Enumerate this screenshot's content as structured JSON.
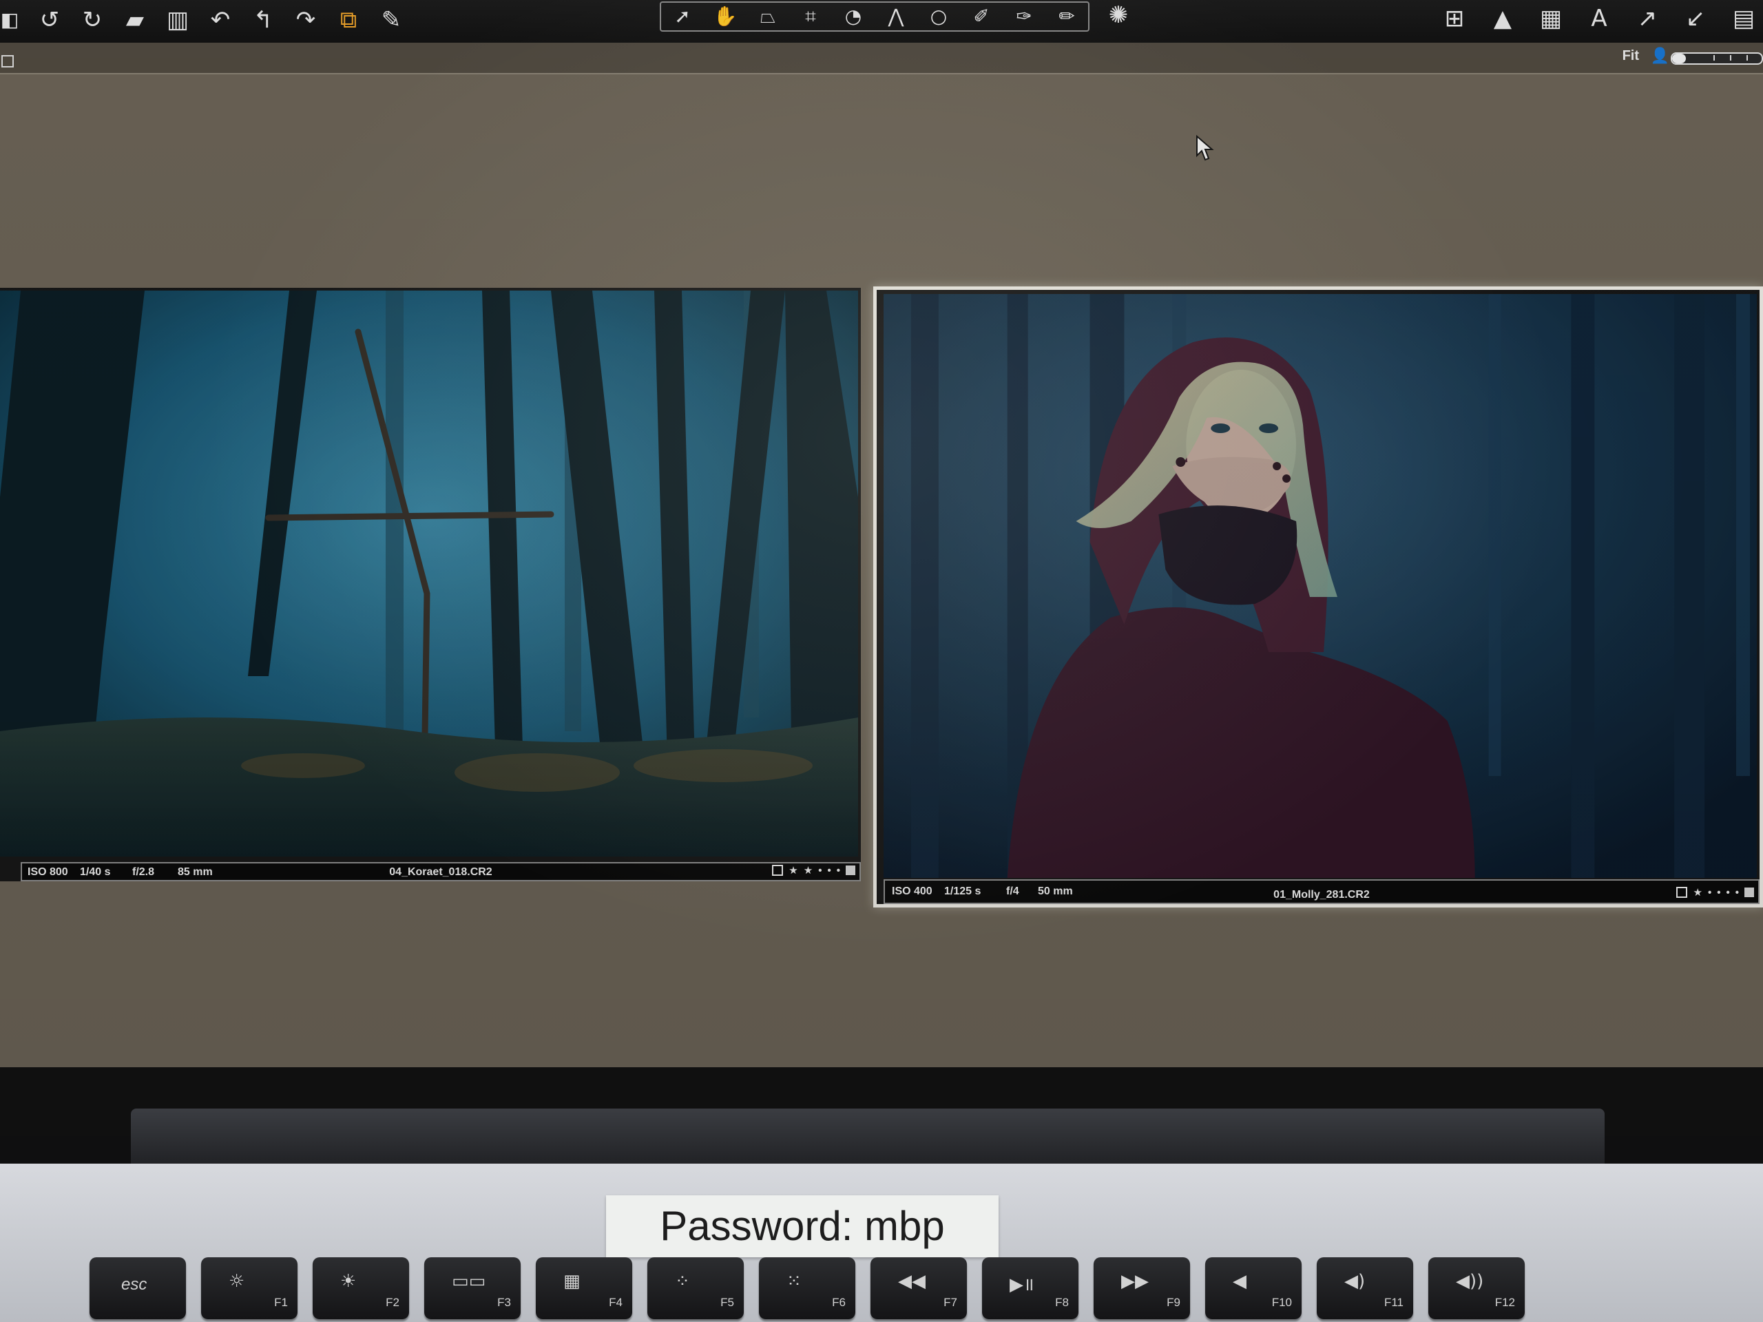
{
  "app": {
    "toolbar": {
      "left_icons": [
        "camera-icon",
        "rotate-left-icon",
        "rotate-right-icon",
        "open-folder-icon",
        "trash-icon",
        "undo-icon",
        "rotate-back-icon",
        "redo-icon",
        "stack-icon",
        "brush-icon"
      ],
      "center_tools": [
        "select-tool-icon",
        "pan-tool-icon",
        "loupe-tool-icon",
        "crop-tool-icon",
        "rotate-tool-icon",
        "keystone-tool-icon",
        "circle-mask-icon",
        "brush-mask-icon",
        "picker-tool-icon",
        "eraser-tool-icon"
      ],
      "right_icons": [
        "grid-icon",
        "warning-icon",
        "layers-icon",
        "text-icon",
        "expand-icon",
        "collapse-icon",
        "print-icon"
      ],
      "accent_color": "#f2a62b"
    },
    "subbar": {
      "fit_label": "Fit",
      "zoom_level": 0.15
    },
    "viewers": [
      {
        "filename": "04_Koraet_018.CR2",
        "iso": "ISO 800",
        "shutter": "1/40 s",
        "aperture": "f/2.8",
        "focal": "85 mm",
        "rating_stars": 2,
        "selected": false
      },
      {
        "filename": "01_Molly_281.CR2",
        "iso": "ISO 400",
        "shutter": "1/125 s",
        "aperture": "f/4",
        "focal": "50 mm",
        "rating_stars": 1,
        "selected": true
      }
    ]
  },
  "laptop": {
    "password_label": "Password: mbp",
    "keys": [
      {
        "label": "esc",
        "glyph": ""
      },
      {
        "label": "F1",
        "glyph": "☼"
      },
      {
        "label": "F2",
        "glyph": "☀"
      },
      {
        "label": "F3",
        "glyph": "▭▭"
      },
      {
        "label": "F4",
        "glyph": "▦"
      },
      {
        "label": "F5",
        "glyph": "⁘"
      },
      {
        "label": "F6",
        "glyph": "⁙"
      },
      {
        "label": "F7",
        "glyph": "◀◀"
      },
      {
        "label": "F8",
        "glyph": "▶॥"
      },
      {
        "label": "F9",
        "glyph": "▶▶"
      },
      {
        "label": "F10",
        "glyph": "◀"
      },
      {
        "label": "F11",
        "glyph": "◀)"
      },
      {
        "label": "F12",
        "glyph": "◀))"
      }
    ]
  }
}
